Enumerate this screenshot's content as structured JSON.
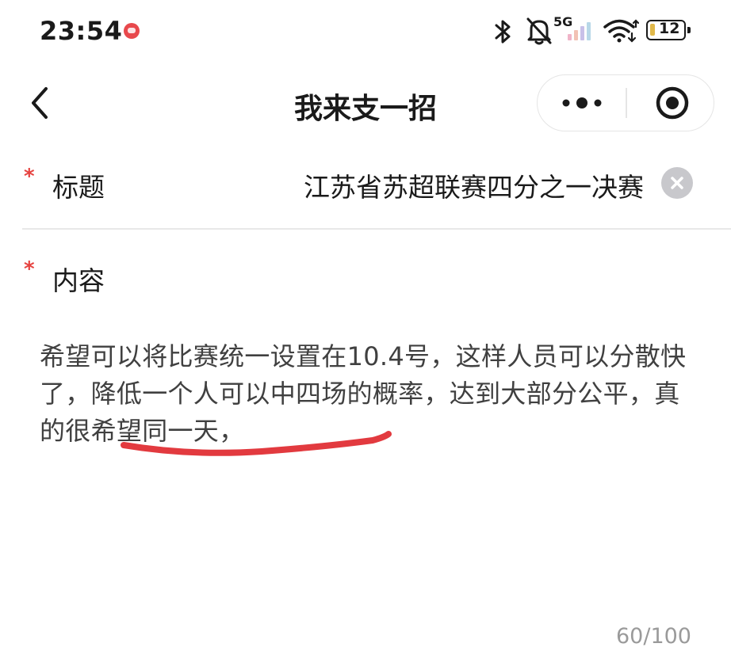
{
  "status_bar": {
    "time": "23:54",
    "network_label": "5G",
    "battery_level": "12",
    "icons": [
      "app-notification-icon",
      "bluetooth-icon",
      "notifications-muted-icon",
      "signal-icon",
      "wifi-icon",
      "battery-icon"
    ]
  },
  "nav": {
    "title": "我来支一招",
    "icons": {
      "back": "chevron-left-icon",
      "more": "more-dots-icon",
      "close": "mini-program-close-icon"
    }
  },
  "form": {
    "required_mark": "*",
    "title_label": "标题",
    "title_value": "江苏省苏超联赛四分之一决赛",
    "content_label": "内容",
    "content_value": "希望可以将比赛统一设置在10.4号，这样人员可以分散快了，降低一个人可以中四场的概率，达到大部分公平，真的很希望同一天，",
    "char_counter": "60/100"
  },
  "colors": {
    "required": "#e64340",
    "annotation_stroke": "#e23a3f",
    "clear_button": "#c8c8cc",
    "counter_text": "#9a9a9a"
  }
}
